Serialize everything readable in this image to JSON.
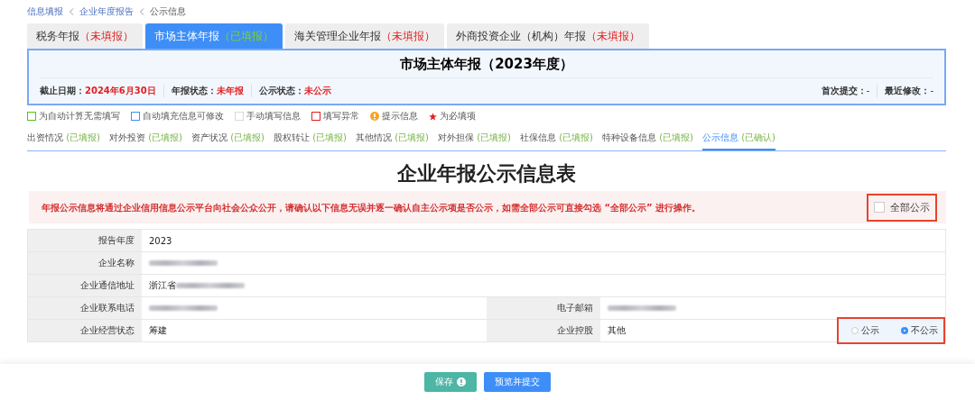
{
  "breadcrumb": [
    "信息填报",
    "企业年度报告",
    "公示信息"
  ],
  "tabs": [
    {
      "label": "税务年报",
      "status": "（未填报）",
      "done": false,
      "selected": false
    },
    {
      "label": "市场主体年报",
      "status": "（已填报）",
      "done": true,
      "selected": true
    },
    {
      "label": "海关管理企业年报",
      "status": "（未填报）",
      "done": false,
      "selected": false
    },
    {
      "label": "外商投资企业（机构）年报",
      "status": "（未填报）",
      "done": false,
      "selected": false
    }
  ],
  "header": {
    "title": "市场主体年报（2023年度）",
    "fields": [
      {
        "label": "截止日期：",
        "value": "2024年6月30日"
      },
      {
        "label": "年报状态：",
        "value": "未年报"
      },
      {
        "label": "公示状态：",
        "value": "未公示"
      }
    ],
    "right_fields": [
      {
        "label": "首次提交：",
        "value": "-"
      },
      {
        "label": "最近修改：",
        "value": "-"
      }
    ]
  },
  "legend": [
    {
      "kind": "square",
      "color": "#52c41a",
      "label": "为自动计算无需填写"
    },
    {
      "kind": "square",
      "color": "#3e8ef7",
      "label": "自动填充信息可修改"
    },
    {
      "kind": "square",
      "color": "#d9d9d9",
      "label": "手动填写信息"
    },
    {
      "kind": "square",
      "color": "#e02020",
      "label": "填写异常"
    },
    {
      "kind": "info",
      "color": "#f5a623",
      "label": "提示信息"
    },
    {
      "kind": "star",
      "color": "#e02020",
      "label": "为必填项"
    }
  ],
  "subtabs": [
    {
      "label": "出资情况",
      "status": "(已填报)",
      "selected": false
    },
    {
      "label": "对外投资",
      "status": "(已填报)",
      "selected": false
    },
    {
      "label": "资产状况",
      "status": "(已填报)",
      "selected": false
    },
    {
      "label": "股权转让",
      "status": "(已填报)",
      "selected": false
    },
    {
      "label": "其他情况",
      "status": "(已填报)",
      "selected": false
    },
    {
      "label": "对外担保",
      "status": "(已填报)",
      "selected": false
    },
    {
      "label": "社保信息",
      "status": "(已填报)",
      "selected": false
    },
    {
      "label": "特种设备信息",
      "status": "(已填报)",
      "selected": false
    },
    {
      "label": "公示信息",
      "status": "(已确认)",
      "selected": true
    }
  ],
  "form_title": "企业年报公示信息表",
  "notice": {
    "text": "年报公示信息将通过企业信用信息公示平台向社会公众公开，请确认以下信息无误并逐一确认自主公示项是否公示，如需全部公示可直接勾选 “全部公示” 进行操作。",
    "all_public": {
      "label": "全部公示",
      "checked": false,
      "highlighted": true
    }
  },
  "rows": [
    {
      "cells": [
        {
          "label": "报告年度",
          "value": "2023",
          "blurred": false
        }
      ]
    },
    {
      "cells": [
        {
          "label": "企业名称",
          "blurred": true
        }
      ]
    },
    {
      "cells": [
        {
          "label": "企业通信地址",
          "value": "浙江省",
          "blurred": true
        }
      ]
    },
    {
      "cells": [
        {
          "label": "企业联系电话",
          "blurred": true
        },
        {
          "label": "电子邮箱",
          "blurred": true
        }
      ]
    },
    {
      "cells": [
        {
          "label": "企业经营状态",
          "value": "筹建",
          "blurred": false
        },
        {
          "label": "企业控股",
          "value": "其他",
          "blurred": false,
          "radio": {
            "highlighted": true,
            "options": [
              {
                "label": "公示",
                "selected": false
              },
              {
                "label": "不公示",
                "selected": true
              }
            ]
          }
        }
      ]
    }
  ],
  "buttons": [
    {
      "kind": "save",
      "label": "保存"
    },
    {
      "kind": "submit",
      "label": "预览并提交"
    }
  ]
}
